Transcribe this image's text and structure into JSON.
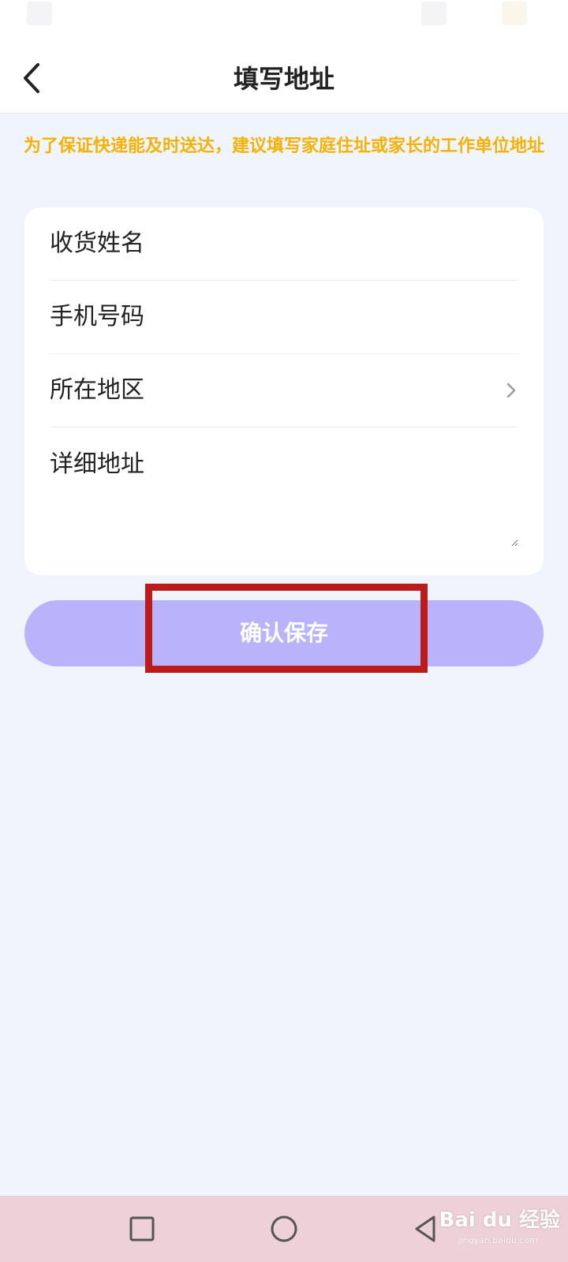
{
  "header": {
    "title": "填写地址",
    "back_icon": "chevron-left-icon"
  },
  "notice": {
    "text": "为了保证快递能及时送达，建议填写家庭住址或家长的工作单位地址",
    "color": "#f4b106"
  },
  "form": {
    "fields": [
      {
        "label": "收货姓名",
        "value": ""
      },
      {
        "label": "手机号码",
        "value": ""
      },
      {
        "label": "所在地区",
        "value": "",
        "icon": "chevron-right-icon"
      },
      {
        "label": "详细地址",
        "value": ""
      }
    ]
  },
  "actions": {
    "save_label": "确认保存",
    "save_color": "#b8b3fa"
  },
  "annotation": {
    "highlight_color": "#bb1b1b"
  },
  "nav": {
    "recent_icon": "square-icon",
    "home_icon": "circle-icon",
    "back_icon": "triangle-back-icon"
  },
  "watermark": {
    "text": "Bai du 经验",
    "subtext": "jingyan.baidu.com"
  },
  "colors": {
    "page_bg": "#f0f4fc",
    "nav_bg": "#eed1d8"
  }
}
